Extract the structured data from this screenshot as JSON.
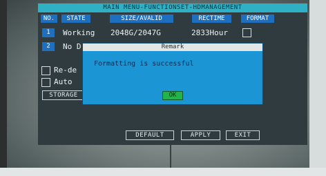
{
  "window": {
    "title": "MAIN MENU-FUNCTIONSET-HDMANAGEMENT"
  },
  "table": {
    "headers": [
      "NO.",
      "STATE",
      "SIZE/AVALID",
      "RECTIME",
      "FORMAT"
    ],
    "rows": [
      {
        "no": "1",
        "state": "Working",
        "size": "2048G/2047G",
        "rectime": "2833Hour"
      },
      {
        "no": "2",
        "state": "No D"
      }
    ]
  },
  "options": [
    {
      "label": "Re-de"
    },
    {
      "label": "Auto"
    }
  ],
  "storage_button": {
    "label": "STORAGE"
  },
  "dialog": {
    "title": "Remark",
    "message": "Formatting is successful",
    "ok_label": "OK"
  },
  "buttons": {
    "default": "DEFAULT",
    "apply": "APPLY",
    "exit": "EXIT"
  },
  "colors": {
    "title_bar": "#2fb0c4",
    "header_bg": "#1f6fc0",
    "dialog_bg": "#1b95d3",
    "ok_bg": "#22b34a"
  },
  "icons": [
    "checkbox-icon"
  ]
}
